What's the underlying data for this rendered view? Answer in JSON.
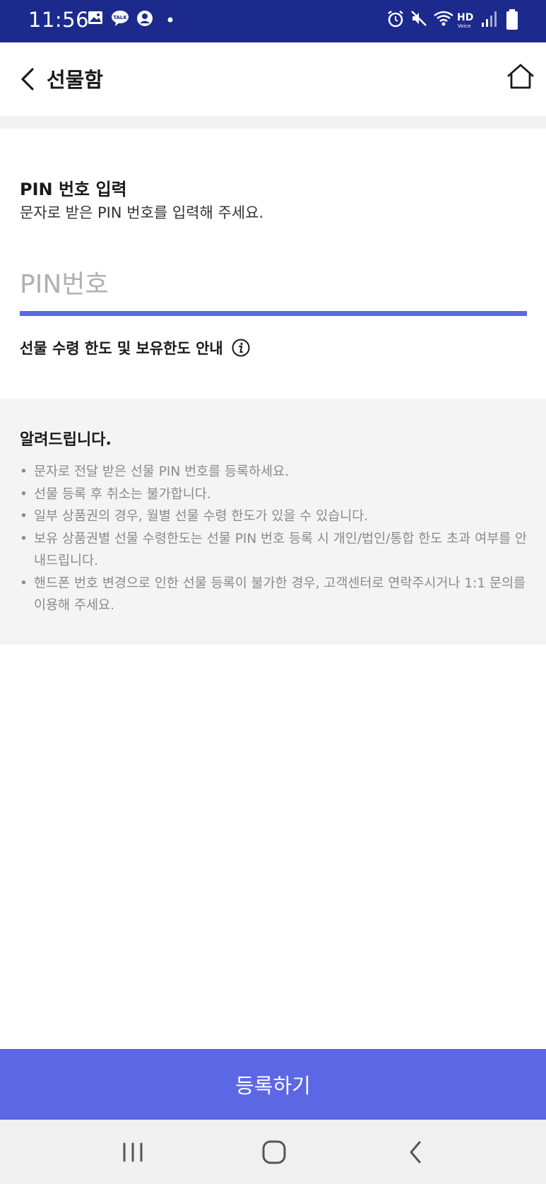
{
  "status_bar": {
    "time": "11:56",
    "icons": [
      "gallery-icon",
      "talk-icon",
      "profile-icon",
      "dot-icon",
      "alarm-icon",
      "mute-icon",
      "wifi-icon",
      "hd-voice-icon",
      "signal-icon",
      "battery-icon"
    ],
    "background": "#1b2a8c"
  },
  "header": {
    "title": "선물함"
  },
  "pin_section": {
    "heading": "PIN 번호 입력",
    "description": "문자로 받은 PIN 번호를 입력해 주세요.",
    "input_placeholder": "PIN번호",
    "input_value": "",
    "limit_info_label": "선물 수령 한도 및 보유한도 안내"
  },
  "notice": {
    "title": "알려드립니다.",
    "items": [
      "문자로 전달 받은 선물 PIN 번호를 등록하세요.",
      "선물 등록 후 취소는 불가합니다.",
      "일부 상품권의 경우, 월별 선물 수령 한도가 있을 수 있습니다.",
      "보유 상품권별 선물 수령한도는 선물 PIN 번호 등록 시 개인/법인/통합 한도 초과 여부를 안내드립니다.",
      "핸드폰 번호 변경으로 인한 선물 등록이 불가한 경우, 고객센터로 연락주시거나 1:1 문의를 이용해 주세요."
    ]
  },
  "register_button": {
    "label": "등록하기"
  },
  "colors": {
    "accent": "#5c67e3",
    "notice_background": "#f4f4f4"
  },
  "nav_bar": {
    "buttons": [
      "recent-apps-icon",
      "home-circle-icon",
      "back-nav-icon"
    ]
  }
}
